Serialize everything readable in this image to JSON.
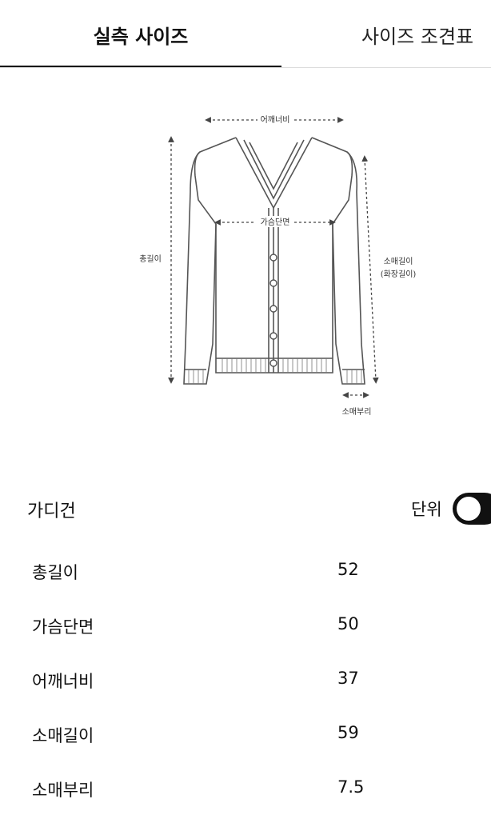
{
  "tabs": [
    {
      "label": "실측 사이즈",
      "active": true
    },
    {
      "label": "사이즈 조견표",
      "active": false
    }
  ],
  "diagram": {
    "labels": {
      "shoulder": "어깨너비",
      "chest": "가슴단면",
      "total_length": "총길이",
      "sleeve_length": "소매길이",
      "sleeve_length_alt": "(화장길이)",
      "cuff": "소매부리"
    }
  },
  "product": {
    "name": "가디건"
  },
  "unit": {
    "label": "단위",
    "toggle_on": true
  },
  "size_rows": [
    {
      "label": "총길이",
      "value": "52"
    },
    {
      "label": "가슴단면",
      "value": "50"
    },
    {
      "label": "어깨너비",
      "value": "37"
    },
    {
      "label": "소매길이",
      "value": "59"
    },
    {
      "label": "소매부리",
      "value": "7.5"
    }
  ],
  "colors": {
    "accent": "#111111",
    "divider": "#dcdcdc",
    "line": "#555555"
  }
}
